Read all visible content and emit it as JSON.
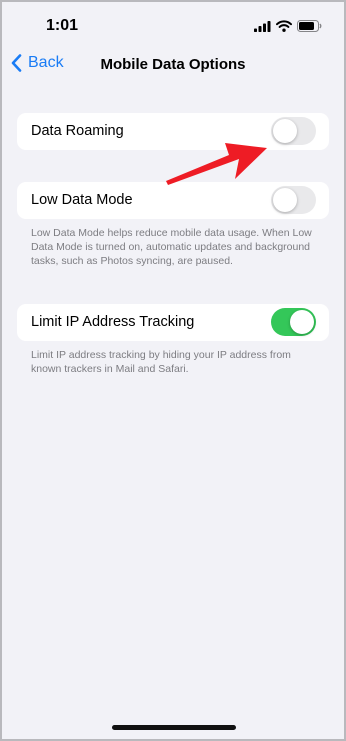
{
  "status_bar": {
    "time": "1:01",
    "icons": [
      "cellular-signal-icon",
      "wifi-icon",
      "battery-icon"
    ]
  },
  "nav": {
    "back_label": "Back",
    "title": "Mobile Data Options",
    "back_icon": "chevron-left-icon"
  },
  "settings": [
    {
      "label": "Data Roaming",
      "enabled": false
    },
    {
      "label": "Low Data Mode",
      "enabled": false,
      "footnote": "Low Data Mode helps reduce mobile data usage. When Low Data Mode is turned on, automatic updates and background tasks, such as Photos syncing, are paused."
    },
    {
      "label": "Limit IP Address Tracking",
      "enabled": true,
      "footnote": "Limit IP address tracking by hiding your IP address from known trackers in Mail and Safari."
    }
  ],
  "annotation": {
    "type": "red-arrow-icon",
    "points_to": "Data Roaming toggle"
  },
  "colors": {
    "accent_blue": "#1a7cf5",
    "toggle_on": "#34c759",
    "toggle_off": "#e9e9eb",
    "background": "#f2f2f7",
    "arrow_red": "#ee1c25"
  }
}
